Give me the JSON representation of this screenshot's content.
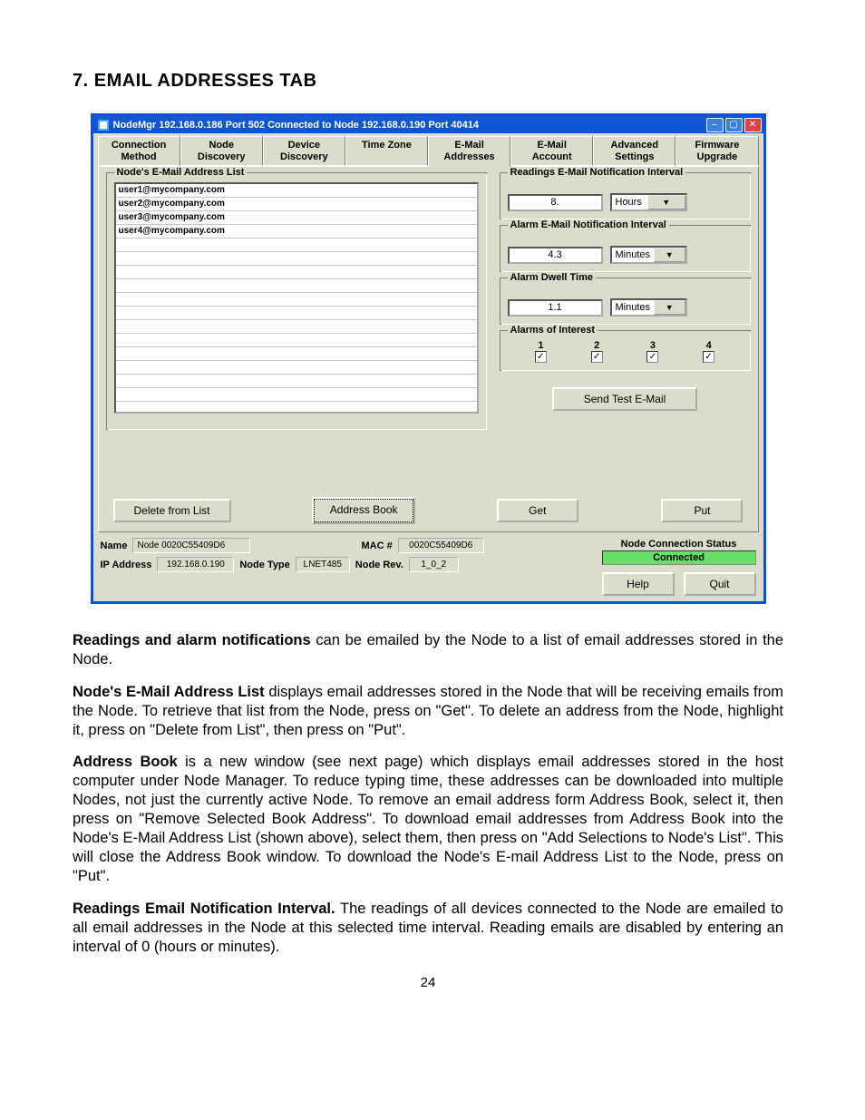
{
  "section_title": "7.  EMAIL ADDRESSES TAB",
  "titlebar": "NodeMgr  192.168.0.186  Port 502   Connected to  Node  192.168.0.190  Port 40414",
  "tabs": {
    "connection_method": "Connection\nMethod",
    "node_discovery": "Node\nDiscovery",
    "device_discovery": "Device\nDiscovery",
    "time_zone": "Time Zone",
    "email_addresses": "E-Mail\nAddresses",
    "email_account": "E-Mail\nAccount",
    "advanced_settings": "Advanced\nSettings",
    "firmware_upgrade": "Firmware\nUpgrade"
  },
  "email_list": {
    "title": "Node's E-Mail Address List",
    "items": [
      "user1@mycompany.com",
      "user2@mycompany.com",
      "user3@mycompany.com",
      "user4@mycompany.com"
    ]
  },
  "readings_interval": {
    "title": "Readings  E-Mail Notification Interval",
    "value": "8.",
    "unit": "Hours"
  },
  "alarm_interval": {
    "title": "Alarm  E-Mail Notification Interval",
    "value": "4.3",
    "unit": "Minutes"
  },
  "dwell": {
    "title": "Alarm  Dwell Time",
    "value": "1.1",
    "unit": "Minutes"
  },
  "alarms": {
    "title": "Alarms of Interest",
    "c1": "1",
    "c2": "2",
    "c3": "3",
    "c4": "4"
  },
  "buttons": {
    "send_test": "Send Test E-Mail",
    "delete": "Delete from List",
    "address_book": "Address Book",
    "get": "Get",
    "put": "Put",
    "help": "Help",
    "quit": "Quit"
  },
  "status": {
    "name_label": "Name",
    "name_value": "Node 0020C55409D6",
    "mac_label": "MAC #",
    "mac_value": "0020C55409D6",
    "ip_label": "IP Address",
    "ip_value": "192.168.0.190",
    "type_label": "Node Type",
    "type_value": "LNET485",
    "rev_label": "Node Rev.",
    "rev_value": "1_0_2",
    "conn_title": "Node Connection Status",
    "conn_value": "Connected"
  },
  "doc": {
    "p1a": "Readings and alarm notifications",
    "p1b": " can be emailed by the Node to a list of email addresses stored in the Node.",
    "p2a": "Node's E-Mail Address List",
    "p2b": " displays email addresses stored in the Node that will be receiving emails from the Node. To retrieve that list from the Node, press on \"Get\". To delete an address from the Node, highlight it, press on \"Delete from List\", then press on \"Put\".",
    "p3a": "Address Book",
    "p3b": " is a new window (see next page) which displays email addresses stored in the host computer under Node Manager. To reduce typing time, these addresses can be downloaded into multiple Nodes, not just the currently active Node. To remove an email address form Address Book, select it, then press on \"Remove Selected Book Address\". To download email addresses from Address Book into the Node's E-Mail Address List (shown above), select them, then press on \"Add Selections to Node's List\". This will close the Address Book window. To download the Node's E-mail Address List to the Node, press on \"Put\".",
    "p4a": "Readings Email Notification Interval.",
    "p4b": " The readings of all devices connected to the Node are emailed to all email addresses in the Node at this selected time interval. Reading emails are disabled by entering an interval of 0 (hours or minutes)."
  },
  "page_number": "24"
}
